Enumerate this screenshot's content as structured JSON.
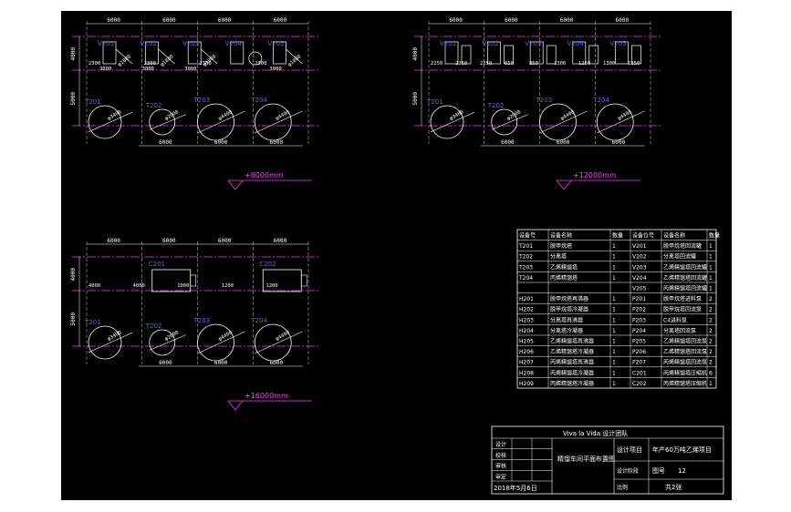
{
  "plans": [
    {
      "level": "+8000mm",
      "top_dims": [
        "6000",
        "6000",
        "6000",
        "6000"
      ],
      "bottom_dims": [
        "6000",
        "6000",
        "6000"
      ],
      "left_dims": [
        "4000",
        "5000"
      ],
      "vessels": [
        {
          "tag": "V201",
          "dia": "φ1800",
          "dim": "3000"
        },
        {
          "tag": "V202",
          "dia": "φ1800",
          "dim": "3000"
        },
        {
          "tag": "V203",
          "dia": "φ1800",
          "dim": "3000"
        },
        {
          "tag": "V204",
          "dia": "",
          "dim": ""
        },
        {
          "tag": "V205",
          "dia": "φ1800",
          "dim": "3000"
        }
      ],
      "towers": [
        {
          "tag": "T201",
          "dia": "φ3400"
        },
        {
          "tag": "T202",
          "dia": "φ2600"
        },
        {
          "tag": "T203",
          "dia": "φ4400"
        },
        {
          "tag": "T204",
          "dia": "φ4400"
        }
      ],
      "small_dims": [
        "2300",
        "2300",
        "2300",
        "2300"
      ]
    },
    {
      "level": "+12000mm",
      "top_dims": [
        "6000",
        "6000",
        "6000",
        "6000"
      ],
      "bottom_dims": [
        "6000",
        "6000",
        "6000"
      ],
      "left_dims": [
        "4000",
        "5000"
      ],
      "vessels": [
        {
          "tag": "V201"
        },
        {
          "tag": "V202"
        },
        {
          "tag": "V203"
        },
        {
          "tag": "V204"
        },
        {
          "tag": "V205"
        }
      ],
      "towers": [
        {
          "tag": "T201",
          "dia": "φ3400"
        },
        {
          "tag": "T202",
          "dia": "φ2600"
        },
        {
          "tag": "T203",
          "dia": "φ4400"
        },
        {
          "tag": "T204",
          "dia": "φ4400"
        }
      ],
      "small_dims": [
        "2250",
        "2250",
        "2250",
        "650",
        "850",
        "1300",
        "1250",
        "1300",
        "2250"
      ]
    },
    {
      "level": "+16000mm",
      "top_dims": [
        "6000",
        "6000",
        "6000",
        "6000"
      ],
      "bottom_dims": [
        "6000",
        "6000",
        "6000"
      ],
      "left_dims": [
        "4000",
        "5000"
      ],
      "vessels": [
        {
          "tag": "C201"
        },
        {
          "tag": "C202"
        }
      ],
      "towers": [
        {
          "tag": "T201",
          "dia": "φ3400"
        },
        {
          "tag": "T202",
          "dia": "φ2600"
        },
        {
          "tag": "T203",
          "dia": "φ4400"
        },
        {
          "tag": "T204",
          "dia": "φ4400"
        }
      ],
      "small_dims": [
        "4000",
        "4000",
        "1000",
        "1200",
        "1200"
      ]
    }
  ],
  "equipment_table": {
    "headers": [
      "设备号",
      "设备名称",
      "数量",
      "设备位号",
      "设备名称",
      "数量"
    ],
    "rows": [
      [
        "T201",
        "脱甲烷塔",
        "1",
        "V201",
        "脱甲烷塔回流罐",
        "1"
      ],
      [
        "T202",
        "分离塔",
        "1",
        "V202",
        "分离塔回流罐",
        "1"
      ],
      [
        "T203",
        "乙烯精馏塔",
        "1",
        "V203",
        "乙烯精馏塔回流罐",
        "1"
      ],
      [
        "T204",
        "丙烯精馏塔",
        "1",
        "V204",
        "乙烯精馏塔回流罐",
        "1"
      ],
      [
        "",
        "",
        "",
        "V205",
        "丙烯精馏塔回流罐",
        "1"
      ],
      [
        "H201",
        "脱甲烷塔再沸器",
        "1",
        "P201",
        "脱甲烷塔进料泵",
        "2"
      ],
      [
        "H202",
        "脱甲烷塔冷凝器",
        "1",
        "P202",
        "脱甲烷塔回流泵",
        "2"
      ],
      [
        "H203",
        "分离塔再沸器",
        "1",
        "P203",
        "C4进料泵",
        "2"
      ],
      [
        "H204",
        "分离塔冷凝器",
        "1",
        "P204",
        "分离塔回流泵",
        "2"
      ],
      [
        "H205",
        "乙烯精馏塔再沸器",
        "1",
        "P205",
        "乙烯精馏塔回流泵",
        "2"
      ],
      [
        "H206",
        "乙烯精馏塔冷凝器",
        "1",
        "P206",
        "乙烯精馏塔回流泵",
        "2"
      ],
      [
        "H207",
        "丙烯精馏塔再沸器",
        "1",
        "P207",
        "丙烯精馏塔回流泵",
        "2"
      ],
      [
        "H208",
        "丙烯精馏塔冷凝器",
        "1",
        "C201",
        "丙烯精馏塔压缩机",
        "6"
      ],
      [
        "H209",
        "丙烯精馏塔冷凝器",
        "1",
        "C202",
        "丙烯精馏塔压缩机",
        "1"
      ]
    ]
  },
  "title_block": {
    "team": "Viva la Vida 设计团队",
    "left_labels": [
      "设计",
      "校核",
      "审核",
      "审定"
    ],
    "date": "2018年5月6日",
    "drawing_title": "精馏车间平面布置图",
    "project_label": "设计项目",
    "project": "年产60万吨乙烯项目",
    "stage_label": "设计阶段",
    "drawing_no_label": "图号",
    "drawing_no": "12",
    "scale_label": "比例",
    "sheet_label": "共2张"
  }
}
